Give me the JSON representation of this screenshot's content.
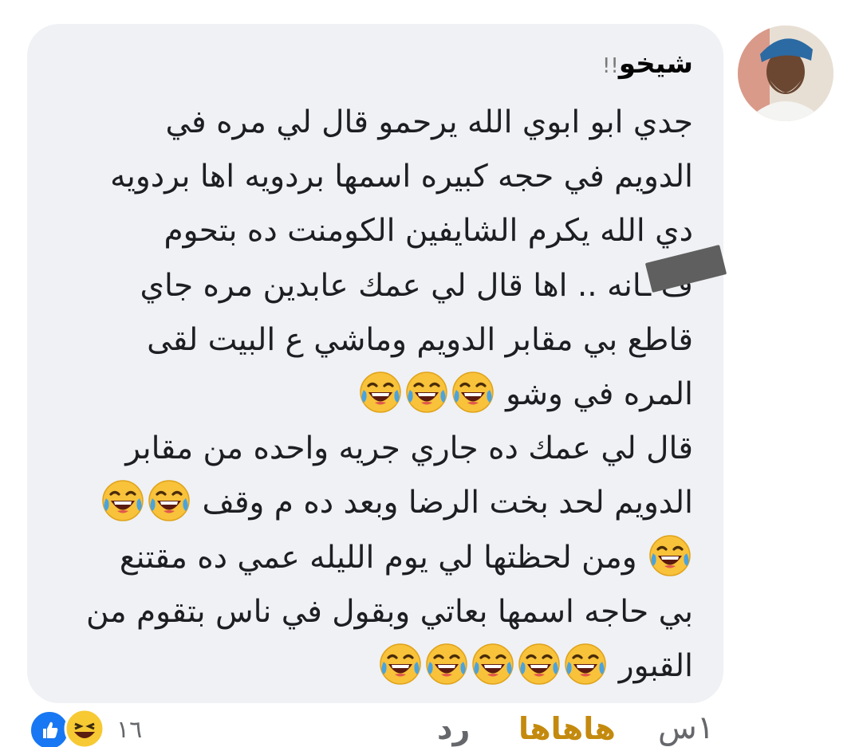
{
  "comment": {
    "author": "شيخو",
    "author_suffix": "!!",
    "lines": [
      {
        "text": "جدي ابو ابوي الله يرحمو قال لي مره في",
        "emojis": 0
      },
      {
        "text": "الدويم في حجه كبيره اسمها بردويه اها بردويه",
        "emojis": 0
      },
      {
        "text": "دي الله يكرم الشايفين الكومنت ده بتحوم",
        "emojis": 0
      },
      {
        "text": "ف ـانه .. اها قال لي عمك عابدين مره جاي",
        "emojis": 0
      },
      {
        "text": "قاطع بي مقابر الدويم وماشي ع البيت لقى",
        "emojis": 0
      },
      {
        "text": "المره في وشو",
        "emojis": 3
      },
      {
        "text": "قال لي عمك ده جاري جريه واحده من مقابر",
        "emojis": 0
      },
      {
        "text": "الدويم لحد بخت الرضا وبعد ده م وقف",
        "emojis": 2
      },
      {
        "text": "ومن لحظتها لي يوم الليله عمي ده مقتنع",
        "emojis": 1,
        "emoji_first": true
      },
      {
        "text": "بي حاجه اسمها بعاتي وبقول في ناس بتقوم من",
        "emojis": 0
      },
      {
        "text": "القبور",
        "emojis": 5
      }
    ],
    "emoji_name": "laughing-tears-emoji"
  },
  "footer": {
    "time": "١س",
    "reaction_label": "هاهاها",
    "reply_label": "رد",
    "reaction_count": "١٦"
  },
  "colors": {
    "bubble": "#eff1f4",
    "reaction_label": "#c48a0e",
    "meta_text": "#65676b",
    "like_blue": "#1877f2"
  }
}
